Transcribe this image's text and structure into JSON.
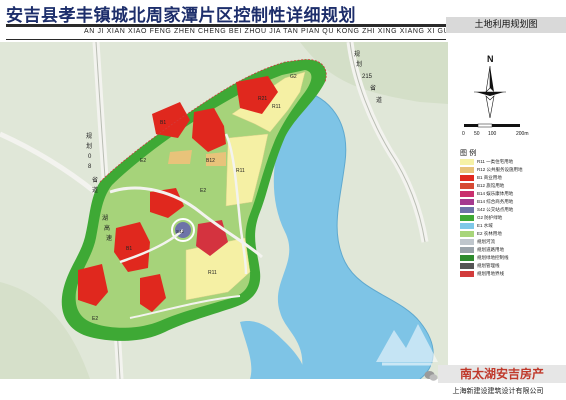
{
  "header": {
    "title": "安吉县孝丰镇城北周家潭片区控制性详细规划",
    "subtitle": "AN JI XIAN XIAO FENG ZHEN CHENG BEI ZHOU JIA TAN PIAN QU KONG ZHI XING XIANG XI GUI HUA",
    "sheet_name": "土地利用规划图"
  },
  "map": {
    "road_labels": {
      "west_road": [
        "规",
        "划",
        "0",
        "8",
        "省",
        "道"
      ],
      "east_road": [
        "规",
        "划",
        "215",
        "省",
        "道"
      ],
      "lake_road": [
        "湖",
        "高",
        "速"
      ]
    },
    "parcel_codes": {
      "e2": "E2",
      "r11": "R11",
      "r21": "R21",
      "b1": "B1",
      "b12": "B12",
      "s42": "S42",
      "g2": "G2"
    }
  },
  "compass": {
    "north_label": "N"
  },
  "scale": {
    "ticks": [
      "0",
      "50",
      "100",
      "200m"
    ]
  },
  "legend": {
    "title": "图 例",
    "items": [
      {
        "label": "R11 一类住宅用地",
        "color": "#f6f2a6"
      },
      {
        "label": "R12 公共服务设施用地",
        "color": "#e8c37a"
      },
      {
        "label": "B1 商业用地",
        "color": "#e0281e"
      },
      {
        "label": "B12 旅馆用地",
        "color": "#d64a34"
      },
      {
        "label": "B14 娱乐康体用地",
        "color": "#c92f6e"
      },
      {
        "label": "B14 综合商务用地",
        "color": "#a53a8f"
      },
      {
        "label": "S42 公交站点用地",
        "color": "#6e73a8"
      },
      {
        "label": "G2 防护绿地",
        "color": "#3ea935"
      },
      {
        "label": "E1 水域",
        "color": "#7fc8e8"
      },
      {
        "label": "E2 农林用地",
        "color": "#a8d57a"
      },
      {
        "label": "规划河流",
        "color": "#bfc6cc"
      },
      {
        "label": "规划道路用地",
        "color": "#9aa3aa"
      },
      {
        "label": "规划绿地控制线",
        "color": "#2e8b2e"
      },
      {
        "label": "规划管理线",
        "color": "#555555"
      },
      {
        "label": "规划用地界线",
        "color": "#d23b3b"
      }
    ]
  },
  "watermark": {
    "text": "南太湖安吉房产"
  },
  "footer": {
    "company": "上海新建设建筑设计有限公司"
  }
}
